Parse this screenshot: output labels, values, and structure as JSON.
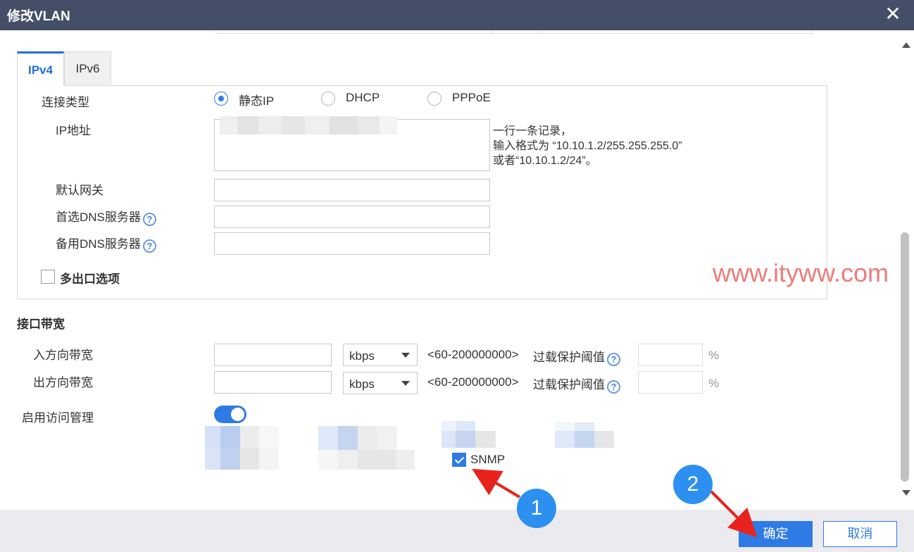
{
  "window": {
    "title": "修改VLAN"
  },
  "tabs": [
    {
      "label": "IPv4"
    },
    {
      "label": "IPv6"
    }
  ],
  "ipv4": {
    "connection_type_label": "连接类型",
    "options": [
      {
        "label": "静态IP",
        "selected": true
      },
      {
        "label": "DHCP",
        "selected": false
      },
      {
        "label": "PPPoE",
        "selected": false
      }
    ],
    "ip_label": "IP地址",
    "ip_hint": [
      "一行一条记录，",
      "输入格式为 “10.10.1.2/255.255.255.0”",
      "或者“10.10.1.2/24”。"
    ],
    "gateway_label": "默认网关",
    "dns1_label": "首选DNS服务器",
    "dns2_label": "备用DNS服务器",
    "multi_exit_label": "多出口选项",
    "help_glyph": "?"
  },
  "bandwidth": {
    "section_title": "接口带宽",
    "in_label": "入方向带宽",
    "out_label": "出方向带宽",
    "unit": "kbps",
    "range": "<60-200000000>",
    "overload_label": "过载保护阈值",
    "percent": "%"
  },
  "access": {
    "label": "启用访问管理",
    "enabled": true,
    "snmp_label": "SNMP",
    "snmp_checked": true
  },
  "watermark": "www.ityww.com",
  "annotations": {
    "badge1": "1",
    "badge2": "2"
  },
  "footer": {
    "ok_label": "确定",
    "cancel_label": "取消"
  },
  "colors": {
    "accent": "#2f7be5",
    "title_bar": "#444e66",
    "annotation": "#2d8ff0",
    "arrow": "#e8231d",
    "watermark": "#ef7a7a"
  }
}
